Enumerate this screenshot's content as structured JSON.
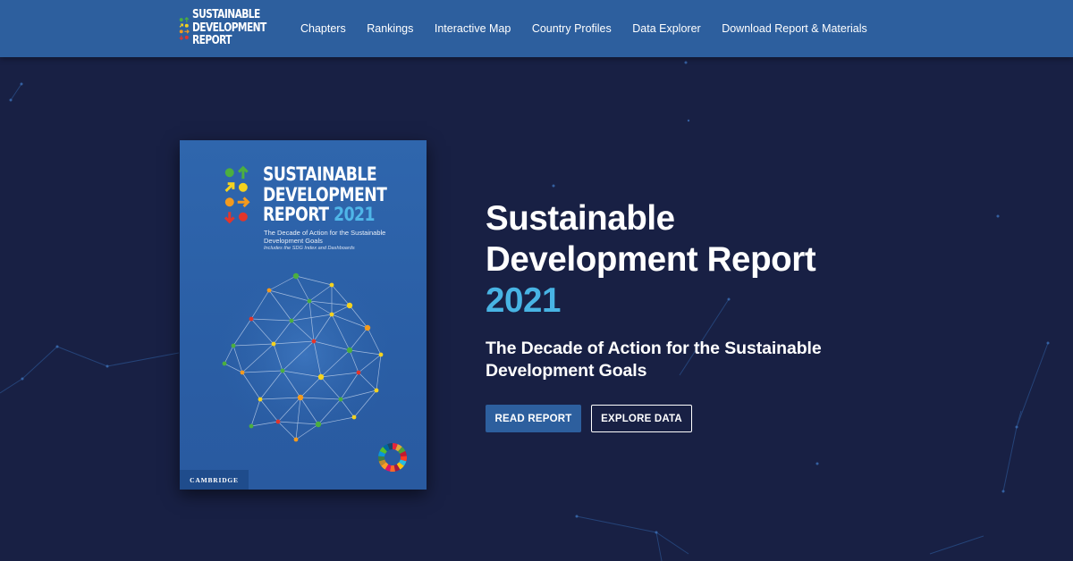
{
  "header": {
    "logo": {
      "lines": [
        "SUSTAINABLE",
        "DEVELOPMENT",
        "REPORT"
      ]
    },
    "nav": [
      {
        "label": "Chapters"
      },
      {
        "label": "Rankings"
      },
      {
        "label": "Interactive Map"
      },
      {
        "label": "Country Profiles"
      },
      {
        "label": "Data Explorer"
      },
      {
        "label": "Download Report & Materials"
      }
    ]
  },
  "cover": {
    "title_lines": [
      "SUSTAINABLE",
      "DEVELOPMENT",
      "REPORT"
    ],
    "title_year": "2021",
    "subtitle": "The Decade of Action for the Sustainable Development Goals",
    "note": "Includes the SDG Index and Dashboards",
    "publisher": "CAMBRIDGE"
  },
  "hero": {
    "title_line1": "Sustainable",
    "title_line2": "Development Report",
    "title_year": "2021",
    "subtitle": "The Decade of Action for the Sustainable Development Goals",
    "buttons": {
      "read": "READ REPORT",
      "explore": "EXPLORE DATA"
    }
  },
  "colors": {
    "background": "#182044",
    "header": "#2d5f9e",
    "accent_blue": "#48b4e4",
    "sdg_green": "#4caf3f",
    "sdg_yellow": "#f4d21f",
    "sdg_orange": "#f39a1e",
    "sdg_red": "#e2352b"
  },
  "icons": [
    "circle-dot-icon",
    "arrow-up-icon",
    "arrow-diagonal-icon",
    "arrow-right-icon",
    "arrow-down-icon",
    "sdg-wheel-icon"
  ]
}
